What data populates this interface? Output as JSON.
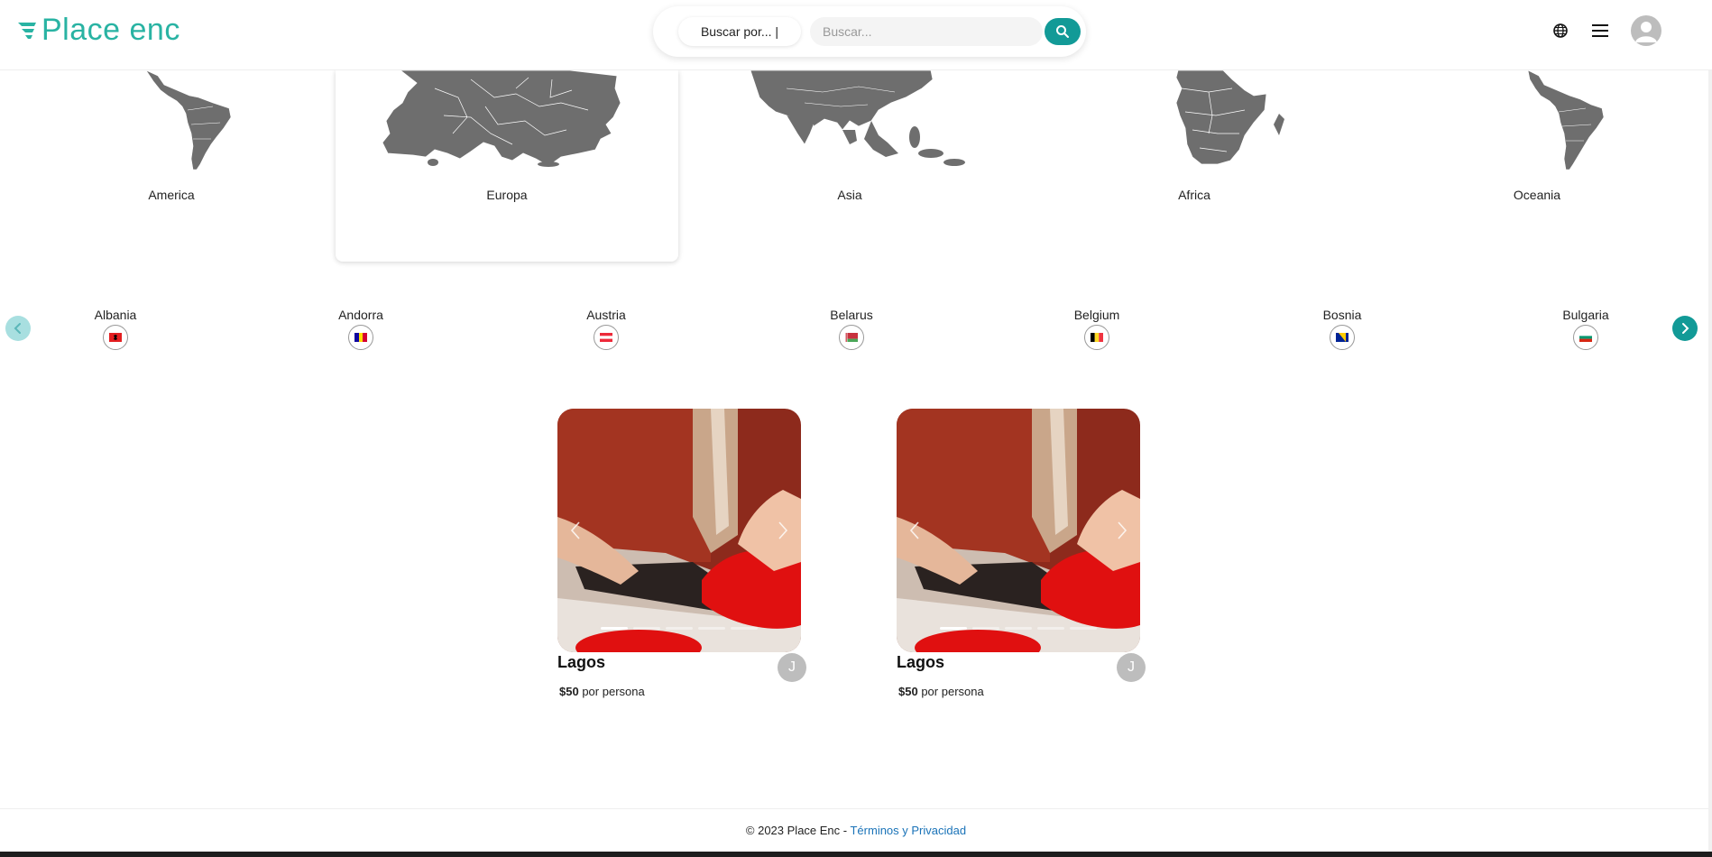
{
  "header": {
    "logo_text": "Place enc",
    "search_type_label": "Buscar por... |",
    "search_placeholder": "Buscar...",
    "search_icon": "search-icon",
    "language_icon": "globe-icon",
    "menu_icon": "hamburger-menu-icon",
    "profile_icon": "user-avatar-icon"
  },
  "continents": [
    {
      "label": "America",
      "selected": false
    },
    {
      "label": "Europa",
      "selected": true
    },
    {
      "label": "Asia",
      "selected": false
    },
    {
      "label": "Africa",
      "selected": false
    },
    {
      "label": "Oceania",
      "selected": false
    }
  ],
  "countries": {
    "prev_icon": "chevron-left-icon",
    "next_icon": "chevron-right-icon",
    "items": [
      {
        "name": "Albania",
        "flag_colors": [
          "#e41e20",
          "#000000"
        ]
      },
      {
        "name": "Andorra",
        "flag_colors": [
          "#10069f",
          "#fedd00",
          "#d50032"
        ]
      },
      {
        "name": "Austria",
        "flag_colors": [
          "#ed2939",
          "#ffffff",
          "#ed2939"
        ]
      },
      {
        "name": "Belarus",
        "flag_colors": [
          "#c8313e",
          "#4aa657"
        ]
      },
      {
        "name": "Belgium",
        "flag_colors": [
          "#000000",
          "#fdda24",
          "#ef3340"
        ]
      },
      {
        "name": "Bosnia",
        "flag_colors": [
          "#002395",
          "#fecb00"
        ]
      },
      {
        "name": "Bulgaria",
        "flag_colors": [
          "#ffffff",
          "#00966e",
          "#d62612"
        ]
      }
    ]
  },
  "listings": [
    {
      "title": "Lagos",
      "price": "$50",
      "price_suffix": "por persona",
      "host_initial": "J"
    },
    {
      "title": "Lagos",
      "price": "$50",
      "price_suffix": "por persona",
      "host_initial": "J"
    }
  ],
  "footer": {
    "copyright": "© 2023 Place Enc - ",
    "link_text": "Términos y Privacidad"
  },
  "colors": {
    "brand": "#29b3a3",
    "accent": "#129a97",
    "map_gray": "#6e6e6e"
  }
}
